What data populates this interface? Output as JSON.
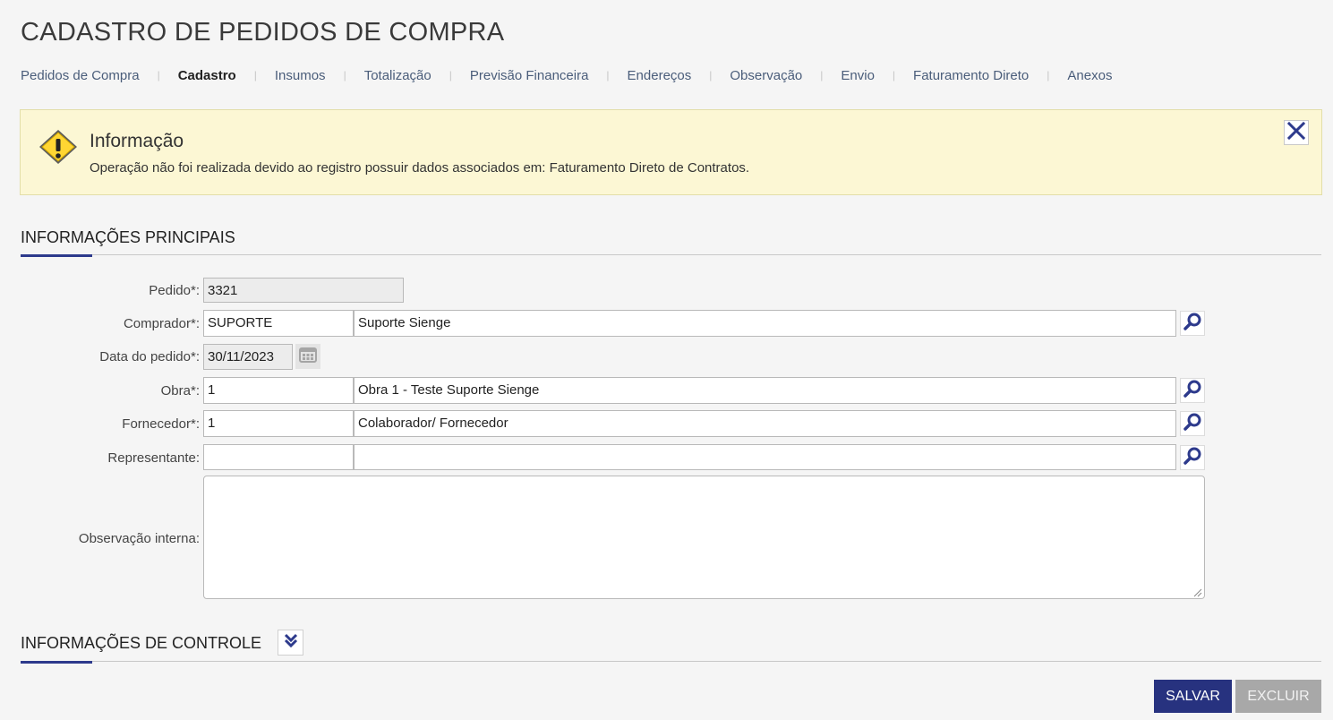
{
  "page": {
    "title": "CADASTRO DE PEDIDOS DE COMPRA"
  },
  "tabs": [
    {
      "label": "Pedidos de Compra",
      "active": false
    },
    {
      "label": "Cadastro",
      "active": true
    },
    {
      "label": "Insumos",
      "active": false
    },
    {
      "label": "Totalização",
      "active": false
    },
    {
      "label": "Previsão Financeira",
      "active": false
    },
    {
      "label": "Endereços",
      "active": false
    },
    {
      "label": "Observação",
      "active": false
    },
    {
      "label": "Envio",
      "active": false
    },
    {
      "label": "Faturamento Direto",
      "active": false
    },
    {
      "label": "Anexos",
      "active": false
    }
  ],
  "alert": {
    "icon": "warning-icon",
    "title": "Informação",
    "message": "Operação não foi realizada devido ao registro possuir dados associados em: Faturamento Direto de Contratos.",
    "close_icon": "close-icon"
  },
  "section_main": {
    "title": "INFORMAÇÕES PRINCIPAIS"
  },
  "form": {
    "pedido": {
      "label": "Pedido*:",
      "value": "3321"
    },
    "comprador": {
      "label": "Comprador*:",
      "code": "SUPORTE",
      "name": "Suporte Sienge"
    },
    "data_pedido": {
      "label": "Data do pedido*:",
      "value": "30/11/2023"
    },
    "obra": {
      "label": "Obra*:",
      "code": "1",
      "name": "Obra 1 - Teste Suporte Sienge"
    },
    "fornecedor": {
      "label": "Fornecedor*:",
      "code": "1",
      "name": "Colaborador/ Fornecedor"
    },
    "representante": {
      "label": "Representante:",
      "code": "",
      "name": ""
    },
    "observacao": {
      "label": "Observação interna:",
      "value": ""
    }
  },
  "section_control": {
    "title": "INFORMAÇÕES DE CONTROLE"
  },
  "actions": {
    "save_label": "SALVAR",
    "delete_label": "EXCLUIR"
  },
  "colors": {
    "primary": "#27327f",
    "accent_line": "#2d3a8c",
    "alert_bg": "#fcf7d4",
    "disabled": "#a8a8a8"
  }
}
